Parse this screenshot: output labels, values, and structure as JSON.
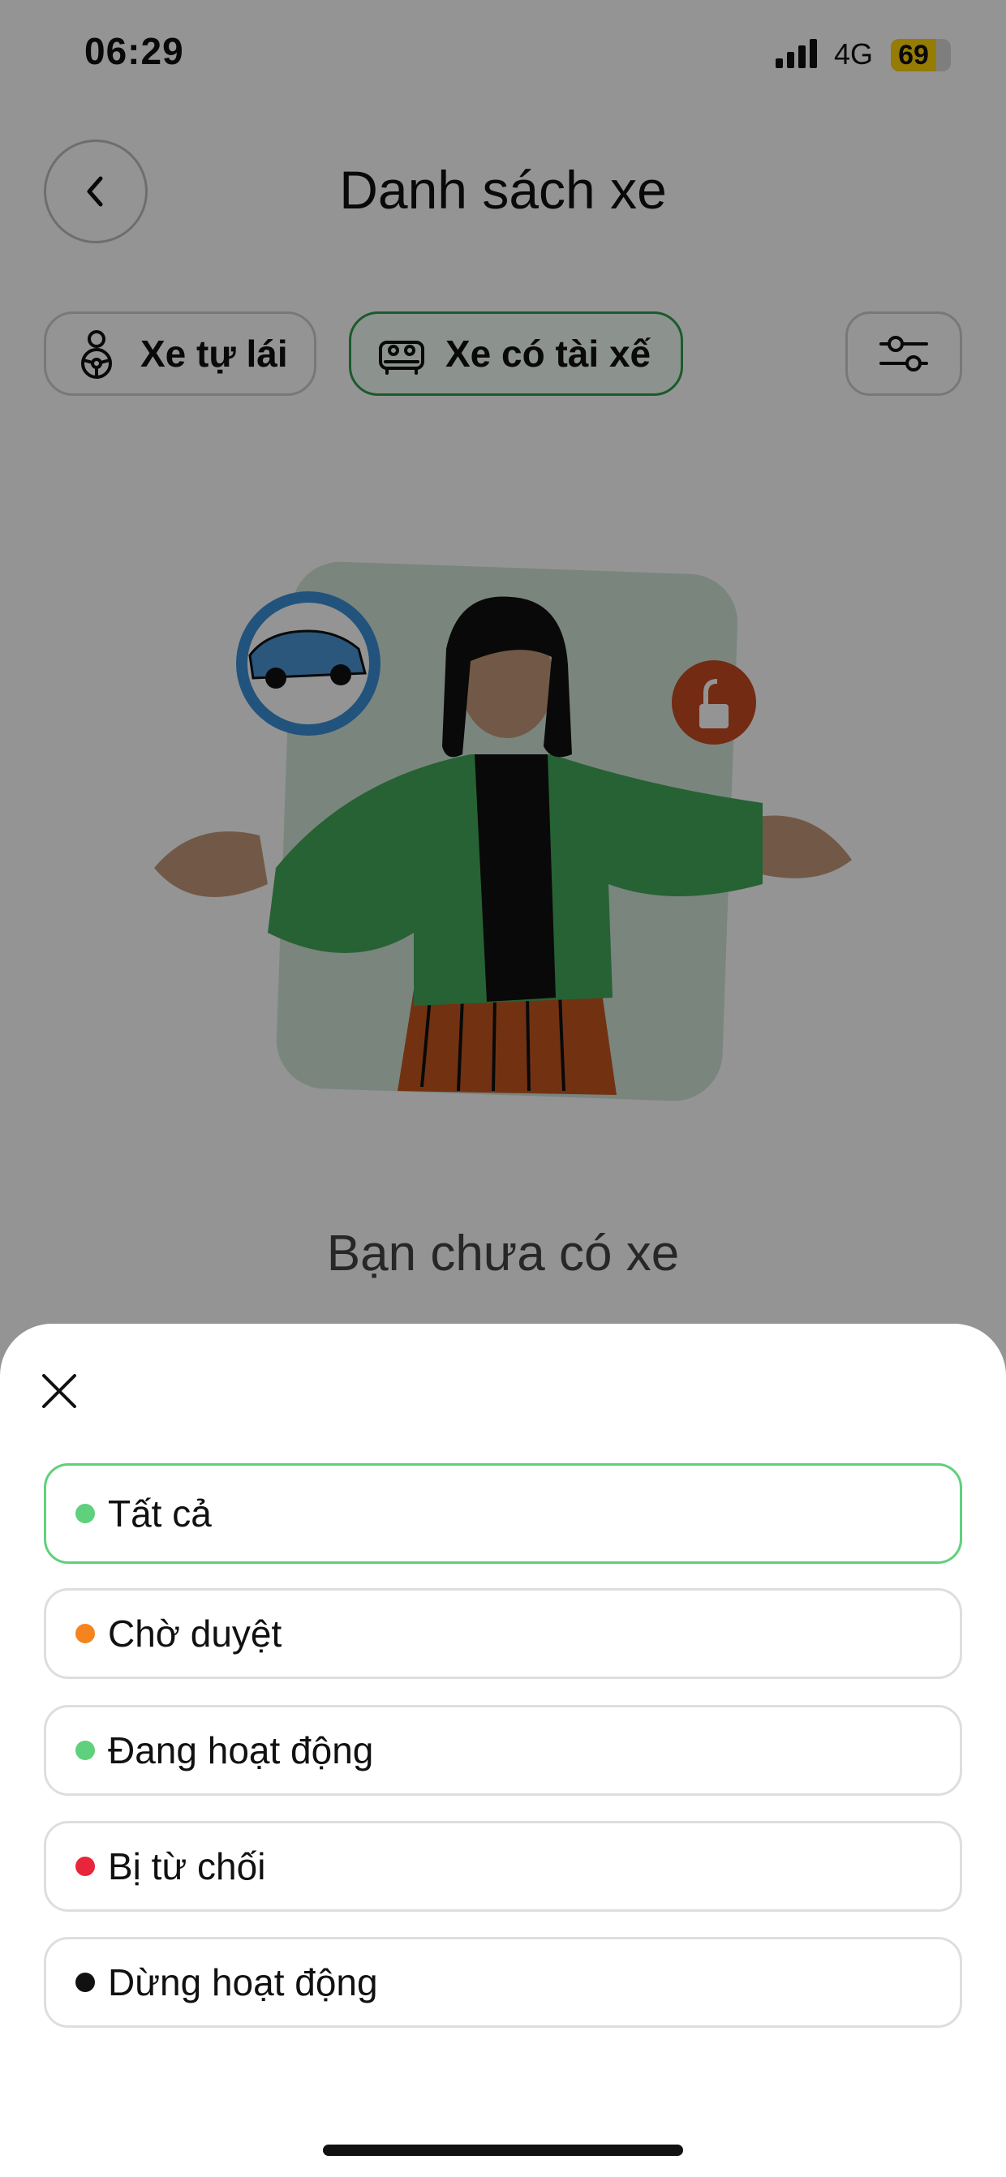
{
  "status_bar": {
    "time": "06:29",
    "network": "4G",
    "battery": "69"
  },
  "header": {
    "title": "Danh sách xe"
  },
  "tabs": [
    {
      "label": "Xe tự lái",
      "icon": "steering-person-icon",
      "active": false
    },
    {
      "label": "Xe có tài xế",
      "icon": "car-seats-icon",
      "active": true
    }
  ],
  "empty_state": {
    "message": "Bạn chưa có xe"
  },
  "sheet": {
    "options": [
      {
        "label": "Tất cả",
        "color": "#5fd07c",
        "selected": true
      },
      {
        "label": "Chờ duyệt",
        "color": "#f5841f",
        "selected": false
      },
      {
        "label": "Đang hoạt động",
        "color": "#5fd07c",
        "selected": false
      },
      {
        "label": "Bị từ chối",
        "color": "#e8253a",
        "selected": false
      },
      {
        "label": "Dừng hoạt động",
        "color": "#111111",
        "selected": false
      }
    ]
  },
  "colors": {
    "accent": "#2e9e4a",
    "overlay": "rgba(0,0,0,0.42)"
  }
}
